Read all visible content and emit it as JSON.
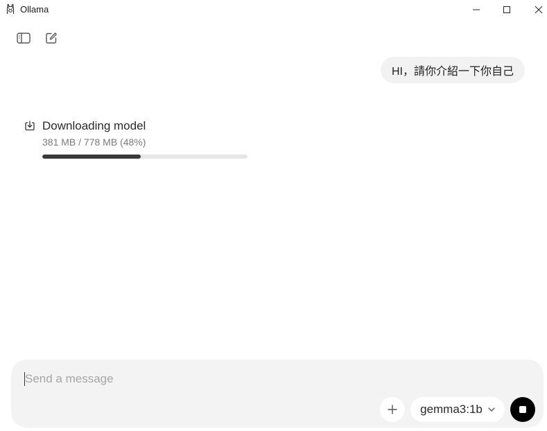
{
  "window": {
    "title": "Ollama"
  },
  "conversation": {
    "user_message": "HI，請你介紹一下你自己"
  },
  "download": {
    "title": "Downloading model",
    "progress_text": "381 MB / 778 MB (48%)",
    "progress_fraction": 0.48
  },
  "composer": {
    "placeholder": "Send a message",
    "model_name": "gemma3:1b"
  },
  "icons": {
    "app": "llama-icon",
    "sidebar": "sidebar-toggle-icon",
    "new_chat": "new-chat-icon",
    "download": "download-icon",
    "attach": "plus-icon",
    "model_dropdown": "chevron-down-icon",
    "stop": "stop-icon"
  }
}
